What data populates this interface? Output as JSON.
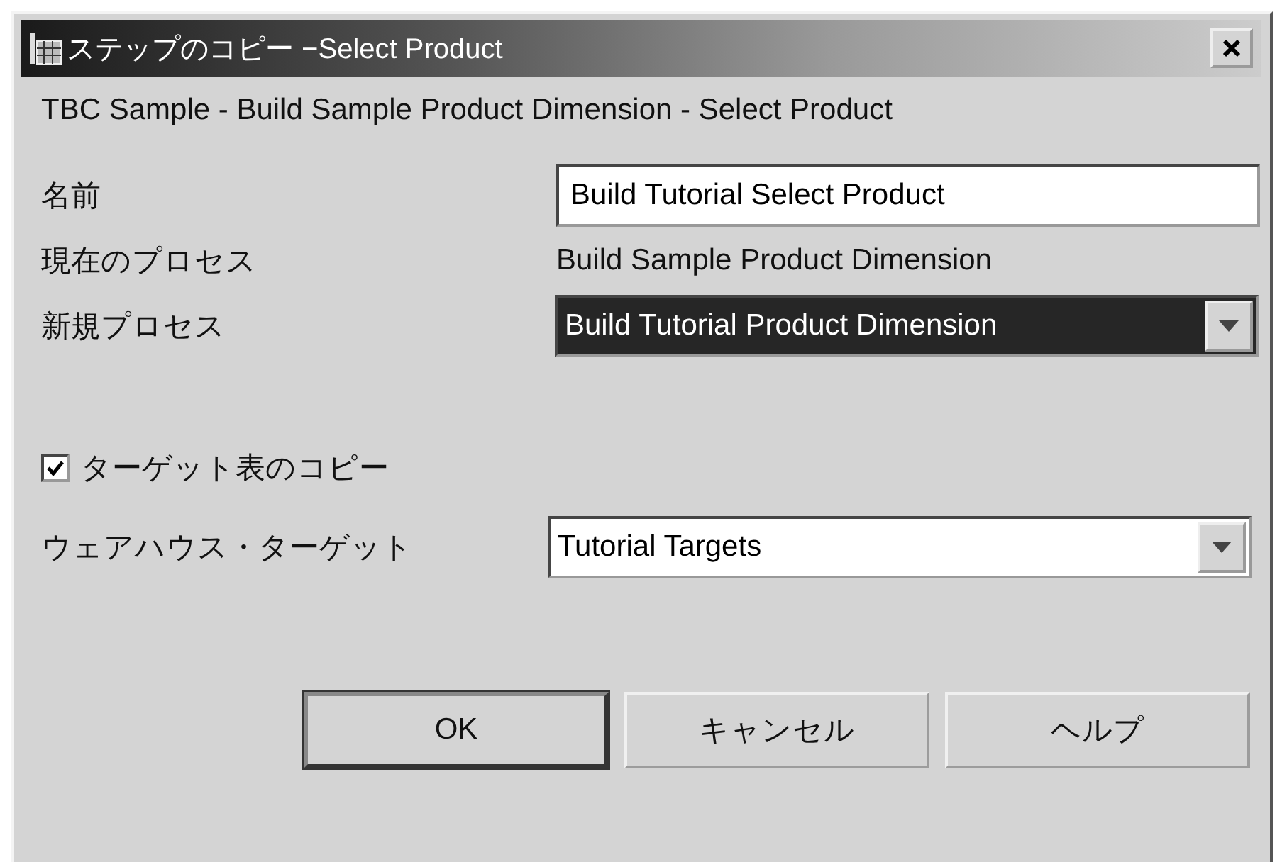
{
  "window": {
    "title": "ステップのコピー −Select Product"
  },
  "subtitle": "TBC Sample - Build Sample Product Dimension - Select Product",
  "fields": [
    {
      "kind": "input",
      "label": "名前",
      "value": "Build Tutorial Select Product"
    },
    {
      "kind": "static",
      "label": "現在のプロセス",
      "value": "Build Sample Product Dimension"
    },
    {
      "kind": "dropdown",
      "label": "新規プロセス",
      "value": "Build Tutorial Product Dimension",
      "focused": true
    }
  ],
  "copy_target_table": {
    "label": "ターゲット表のコピー",
    "checked": true
  },
  "warehouse_target": {
    "kind": "dropdown",
    "label": "ウェアハウス・ターゲット",
    "value": "Tutorial Targets",
    "focused": false
  },
  "buttons": [
    {
      "label": "OK",
      "default": true
    },
    {
      "label": "キャンセル",
      "default": false
    },
    {
      "label": "ヘルプ",
      "default": false
    }
  ]
}
